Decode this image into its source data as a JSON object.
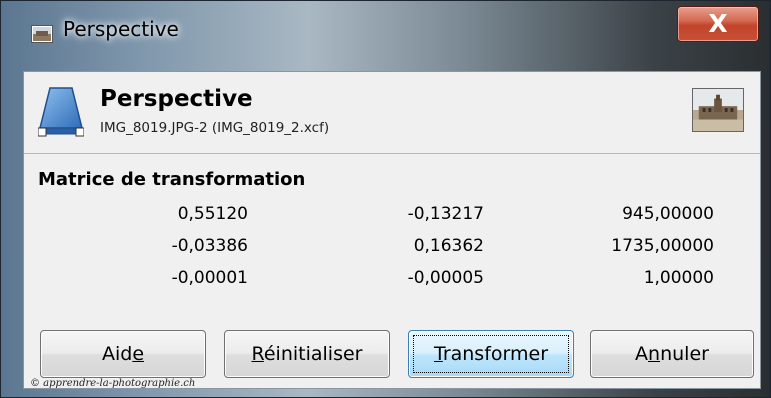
{
  "window": {
    "title": "Perspective",
    "close_label": "X"
  },
  "header": {
    "title": "Perspective",
    "subtitle": "IMG_8019.JPG-2 (IMG_8019_2.xcf)"
  },
  "matrix": {
    "label": "Matrice de transformation",
    "rows": [
      [
        "0,55120",
        "-0,13217",
        "945,00000"
      ],
      [
        "-0,03386",
        "0,16362",
        "1735,00000"
      ],
      [
        "-0,00001",
        "-0,00005",
        "1,00000"
      ]
    ]
  },
  "buttons": {
    "help": {
      "pre": "Aid",
      "key": "e",
      "post": ""
    },
    "reset": {
      "pre": "",
      "key": "R",
      "post": "éinitialiser"
    },
    "transform": {
      "pre": "",
      "key": "T",
      "post": "ransformer"
    },
    "cancel": {
      "pre": "A",
      "key": "n",
      "post": "nuler"
    }
  },
  "watermark": "© apprendre-la-photographie.ch",
  "icons": {
    "window_icon": "image-window-icon",
    "tool_icon": "perspective-tool-icon",
    "thumbnail": "image-thumbnail"
  },
  "colors": {
    "close_button": "#c1442b",
    "default_button": "#bee6fd",
    "client_bg": "#f0f0f0"
  }
}
